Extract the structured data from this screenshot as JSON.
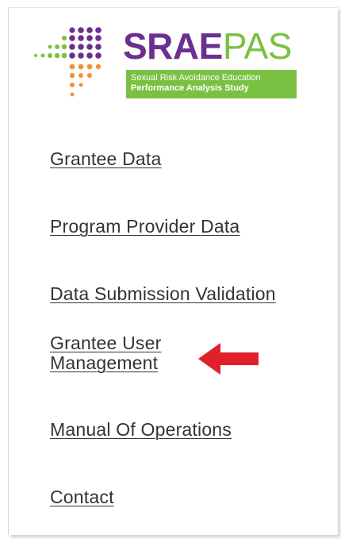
{
  "logo": {
    "brand_part1": "SRAE",
    "brand_part2": "PAS",
    "tagline_line1": "Sexual Risk Avoidance Education",
    "tagline_line2": "Performance Analysis Study",
    "colors": {
      "purple": "#6b2f8f",
      "green": "#7ac143",
      "orange": "#f0923a"
    }
  },
  "nav": {
    "items": [
      {
        "label": "Grantee Data"
      },
      {
        "label": "Program Provider Data"
      },
      {
        "label": "Data Submission Validation"
      },
      {
        "label": "Grantee User Management",
        "highlighted": true
      },
      {
        "label": "Manual Of Operations"
      },
      {
        "label": "Contact"
      }
    ]
  },
  "annotation": {
    "icon": "red-left-arrow-icon",
    "color": "#e0202a"
  }
}
